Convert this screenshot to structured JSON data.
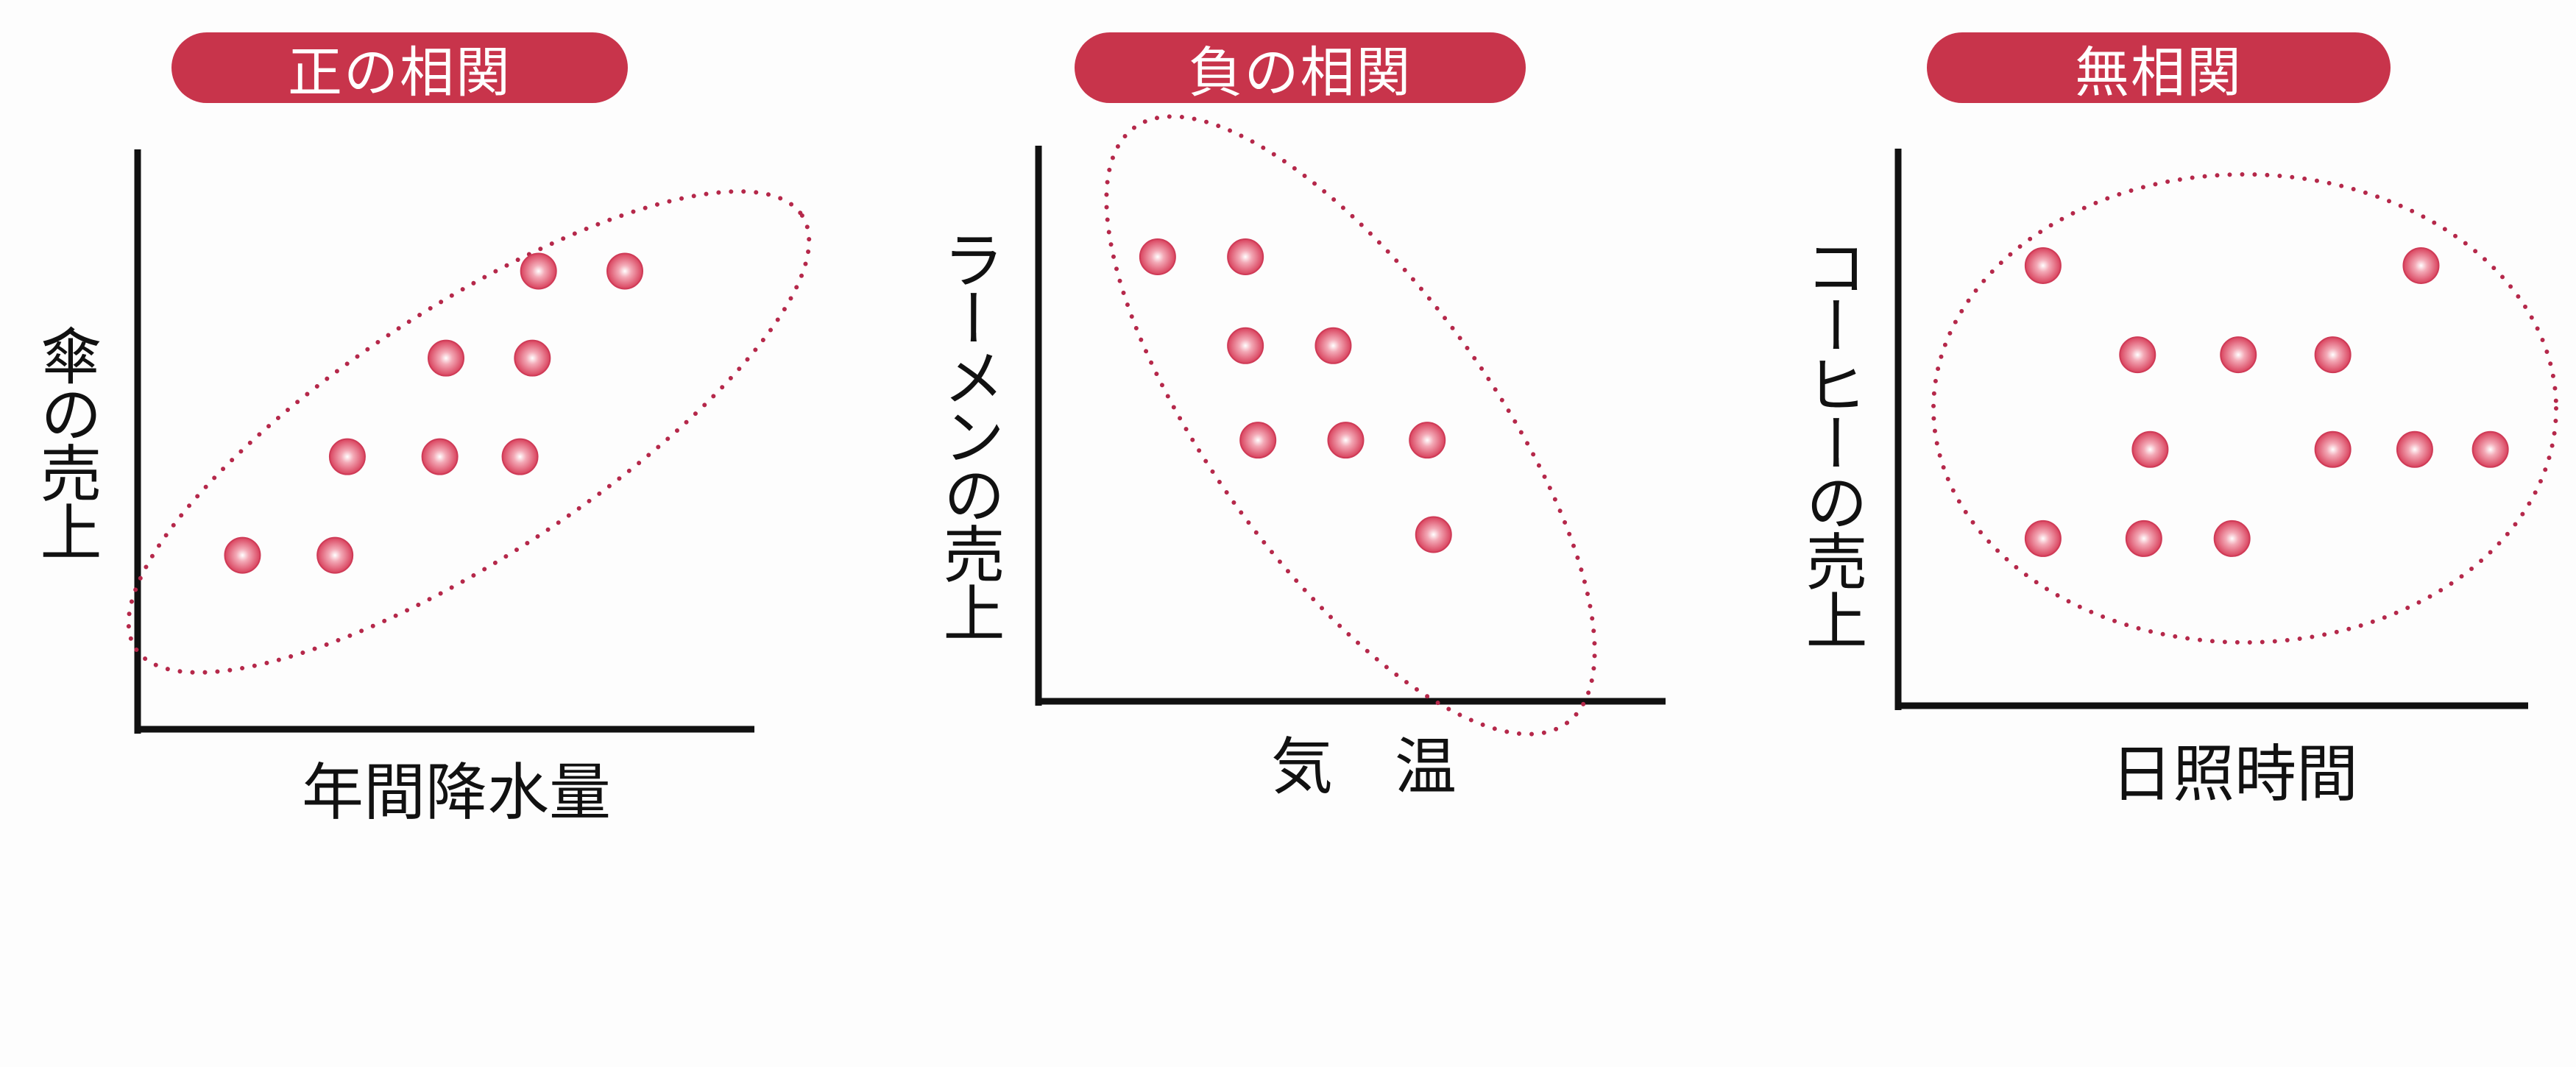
{
  "colors": {
    "pill": "#c8344b",
    "point": "#d9435e",
    "ellipse": "#b5284a",
    "axis": "#111111"
  },
  "chart_data": [
    {
      "type": "scatter",
      "title": "正の相関",
      "xlabel": "年間降水量",
      "ylabel": "傘の売上",
      "xlim": [
        0,
        10
      ],
      "ylim": [
        0,
        10
      ],
      "grid": false,
      "enclosure": "tilted ellipse (dotted)",
      "points": [
        {
          "x": 6.5,
          "y": 7.9
        },
        {
          "x": 7.9,
          "y": 7.9
        },
        {
          "x": 5.0,
          "y": 6.4
        },
        {
          "x": 6.4,
          "y": 6.4
        },
        {
          "x": 3.4,
          "y": 4.7
        },
        {
          "x": 4.9,
          "y": 4.7
        },
        {
          "x": 6.2,
          "y": 4.7
        },
        {
          "x": 1.7,
          "y": 3.0
        },
        {
          "x": 3.2,
          "y": 3.0
        }
      ]
    },
    {
      "type": "scatter",
      "title": "負の相関",
      "xlabel": "気　温",
      "ylabel": "ラーメンの売上",
      "xlim": [
        0,
        10
      ],
      "ylim": [
        0,
        10
      ],
      "grid": false,
      "enclosure": "tilted ellipse (dotted)",
      "points": [
        {
          "x": 1.9,
          "y": 8.0
        },
        {
          "x": 3.3,
          "y": 8.0
        },
        {
          "x": 3.3,
          "y": 6.4
        },
        {
          "x": 4.7,
          "y": 6.4
        },
        {
          "x": 3.5,
          "y": 4.7
        },
        {
          "x": 4.9,
          "y": 4.7
        },
        {
          "x": 6.2,
          "y": 4.7
        },
        {
          "x": 6.3,
          "y": 3.0
        }
      ]
    },
    {
      "type": "scatter",
      "title": "無相関",
      "xlabel": "日照時間",
      "ylabel": "コーヒーの売上",
      "xlim": [
        0,
        10
      ],
      "ylim": [
        0,
        10
      ],
      "grid": false,
      "enclosure": "circle (dotted)",
      "points": [
        {
          "x": 2.3,
          "y": 7.9
        },
        {
          "x": 8.3,
          "y": 7.9
        },
        {
          "x": 3.8,
          "y": 6.3
        },
        {
          "x": 5.4,
          "y": 6.3
        },
        {
          "x": 6.9,
          "y": 6.3
        },
        {
          "x": 4.0,
          "y": 4.6
        },
        {
          "x": 6.9,
          "y": 4.6
        },
        {
          "x": 8.2,
          "y": 4.6
        },
        {
          "x": 9.4,
          "y": 4.6
        },
        {
          "x": 2.3,
          "y": 3.0
        },
        {
          "x": 3.9,
          "y": 3.0
        },
        {
          "x": 5.3,
          "y": 3.0
        }
      ]
    }
  ]
}
